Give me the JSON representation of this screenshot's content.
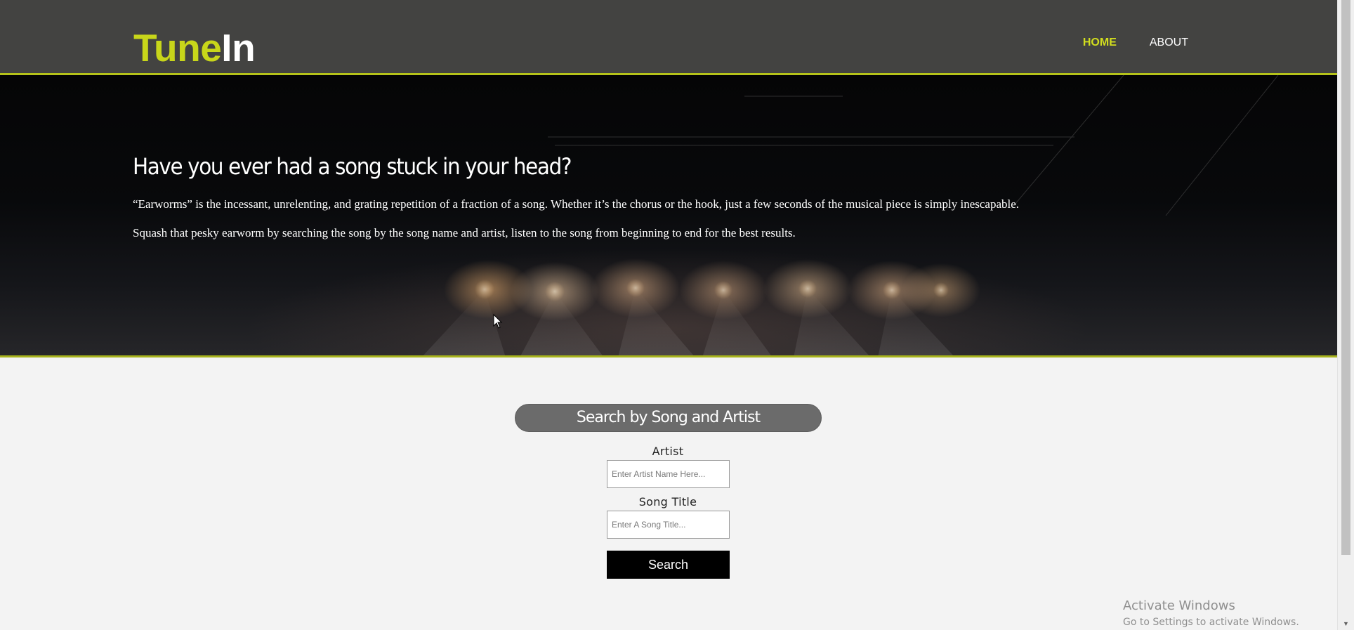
{
  "header": {
    "logo_part1": "Tune",
    "logo_part2": "In",
    "nav": {
      "home": "HOME",
      "about": "ABOUT"
    }
  },
  "hero": {
    "heading": "Have you ever had a song stuck in your head?",
    "paragraph1": "“Earworms” is the incessant, unrelenting, and grating repetition of a fraction of a song. Whether it’s the chorus or the hook, just a few seconds of the musical piece is simply inescapable.",
    "paragraph2": "Squash that pesky earworm by searching the song by the song name and artist, listen to the song from beginning to end for the best results."
  },
  "search": {
    "title": "Search by Song and Artist",
    "artist_label": "Artist",
    "artist_placeholder": "Enter Artist Name Here...",
    "artist_value": "",
    "song_label": "Song Title",
    "song_placeholder": "Enter A Song Title...",
    "song_value": "",
    "button_label": "Search"
  },
  "watermark": {
    "line1": "Activate Windows",
    "line2": "Go to Settings to activate Windows."
  },
  "colors": {
    "accent": "#c8d61a",
    "header_bg": "#434341",
    "pill_bg": "#6b6b6b",
    "button_bg": "#000000",
    "page_bg": "#f3f3f3"
  },
  "icons": {
    "cursor": "arrow-pointer-icon",
    "scroll_up": "chevron-up-icon",
    "scroll_down": "chevron-down-icon"
  }
}
